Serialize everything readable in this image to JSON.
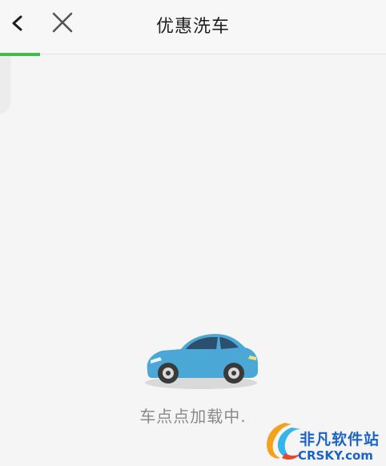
{
  "header": {
    "title": "优惠洗车",
    "back_icon": "chevron-left-icon",
    "close_icon": "close-icon"
  },
  "progress": {
    "value": 0.1,
    "color": "#3fbe4a"
  },
  "loading": {
    "text": "车点点加载中.",
    "illustration": "car-icon"
  },
  "watermark": {
    "name": "非凡软件站",
    "site": "CRSKY.com"
  },
  "colors": {
    "background": "#f5f5f5",
    "car": "#4aa7d6",
    "watermark": "#1b63c6"
  }
}
